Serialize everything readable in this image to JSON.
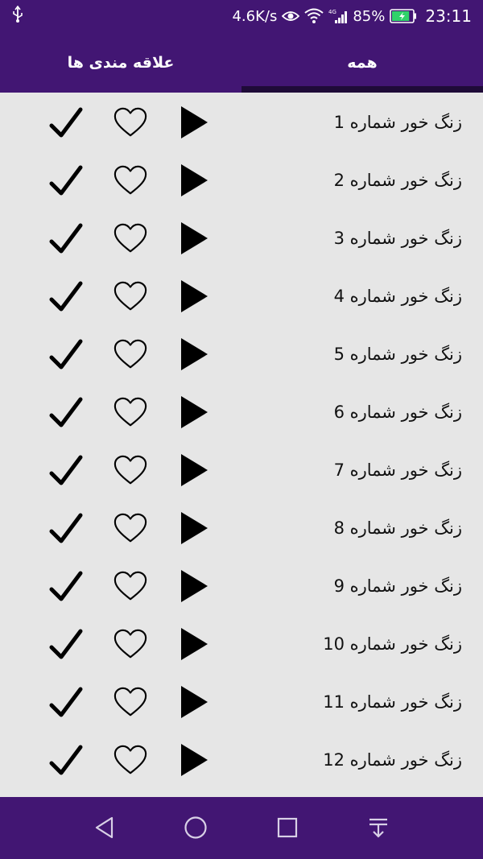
{
  "status_bar": {
    "network_speed": "4.6K/s",
    "battery_percent": "85%",
    "battery_level": 0.85,
    "time": "23:11",
    "icons": [
      "usb-icon",
      "eye-icon",
      "wifi-icon",
      "signal-4g-icon",
      "battery-charging-icon"
    ]
  },
  "tabs": [
    {
      "label": "همه",
      "selected": true
    },
    {
      "label": "علاقه مندی ها",
      "selected": false
    }
  ],
  "ringtones": [
    {
      "label": "زنگ خور شماره 1"
    },
    {
      "label": "زنگ خور شماره 2"
    },
    {
      "label": "زنگ خور شماره 3"
    },
    {
      "label": "زنگ خور شماره 4"
    },
    {
      "label": "زنگ خور شماره 5"
    },
    {
      "label": "زنگ خور شماره 6"
    },
    {
      "label": "زنگ خور شماره 7"
    },
    {
      "label": "زنگ خور شماره 8"
    },
    {
      "label": "زنگ خور شماره 9"
    },
    {
      "label": "زنگ خور شماره 10"
    },
    {
      "label": "زنگ خور شماره 11"
    },
    {
      "label": "زنگ خور شماره 12"
    }
  ],
  "row_icons": [
    "play-icon",
    "heart-outline-icon",
    "checkmark-icon"
  ],
  "nav_bar": {
    "icons": [
      "back-icon",
      "home-icon",
      "recents-icon",
      "notification-pulldown-icon"
    ]
  },
  "colors": {
    "primary": "#421673",
    "tab_indicator": "#1f0b38",
    "background": "#e6e6e6",
    "battery_green": "#2fd26a"
  }
}
